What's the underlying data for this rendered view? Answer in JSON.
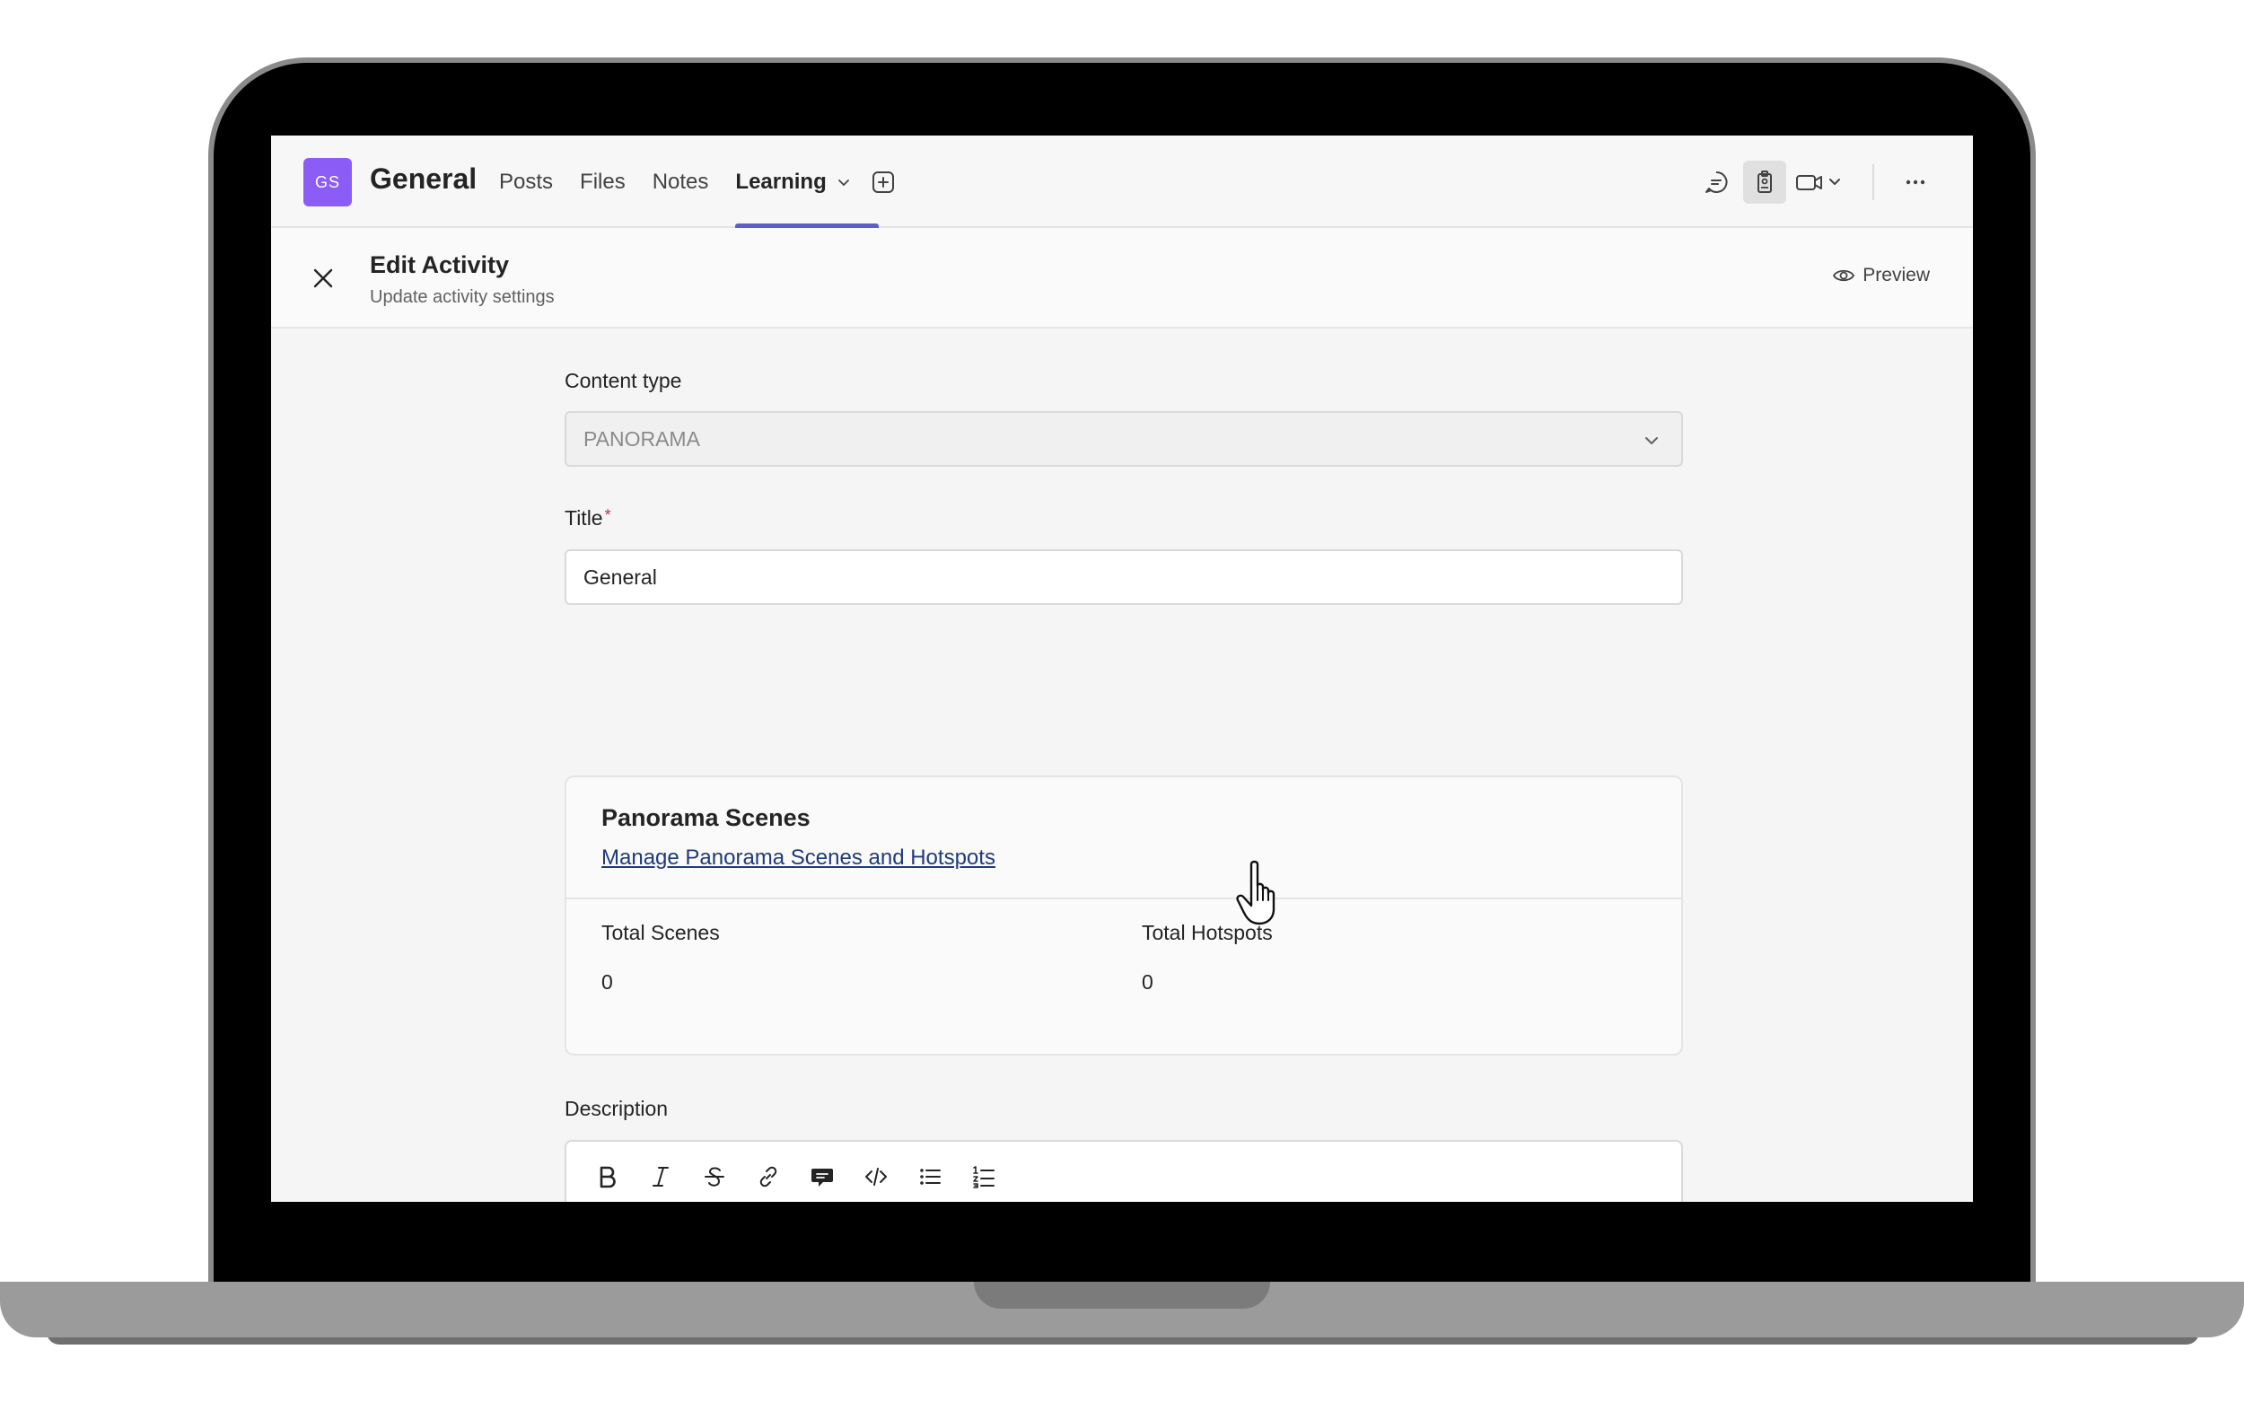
{
  "header": {
    "team_initials": "GS",
    "team_name": "General",
    "tabs": [
      {
        "label": "Posts",
        "active": false
      },
      {
        "label": "Files",
        "active": false
      },
      {
        "label": "Notes",
        "active": false
      },
      {
        "label": "Learning",
        "active": true
      }
    ]
  },
  "subheader": {
    "title": "Edit Activity",
    "description": "Update activity settings",
    "preview_label": "Preview"
  },
  "form": {
    "content_type_label": "Content type",
    "content_type_value": "PANORAMA",
    "title_label": "Title",
    "title_required_mark": "*",
    "title_value": "General",
    "panorama": {
      "heading": "Panorama Scenes",
      "manage_link": "Manage Panorama Scenes and Hotspots",
      "total_scenes_label": "Total Scenes",
      "total_scenes_value": "0",
      "total_hotspots_label": "Total Hotspots",
      "total_hotspots_value": "0"
    },
    "description_label": "Description",
    "toolbar_icons": [
      "bold-icon",
      "italic-icon",
      "strikethrough-icon",
      "link-icon",
      "comment-icon",
      "code-icon",
      "bullet-list-icon",
      "numbered-list-icon"
    ]
  },
  "colors": {
    "accent": "#5b5fc7",
    "avatar": "#8b5cf6",
    "link": "#1f3b7a",
    "required": "#c4314b"
  }
}
